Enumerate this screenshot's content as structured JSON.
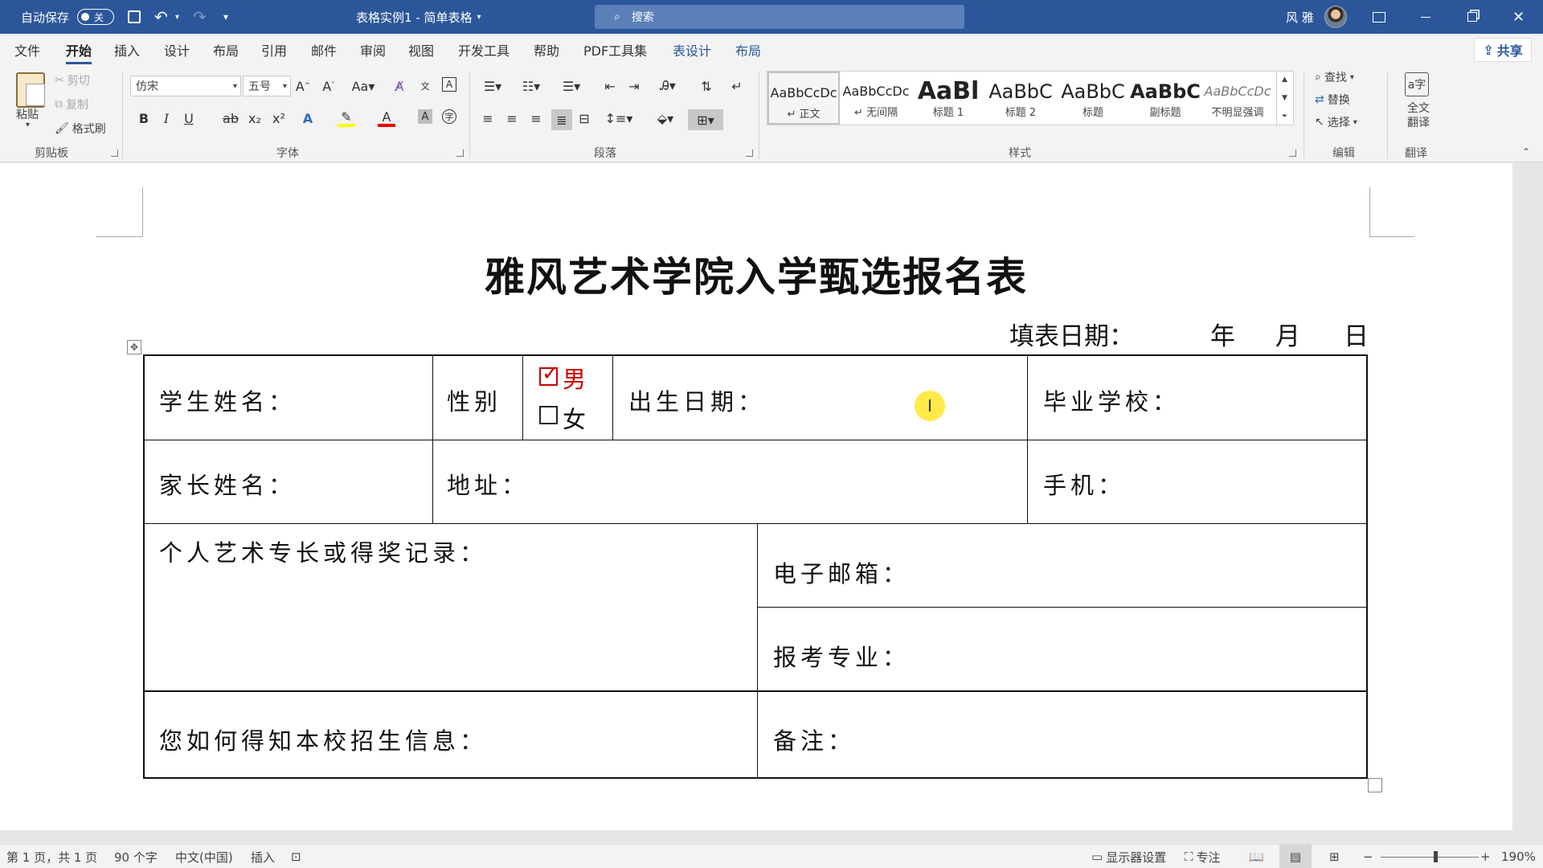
{
  "titlebar": {
    "autosave_label": "自动保存",
    "autosave_state": "关",
    "doc_title": "表格实例1 - 简单表格",
    "search_placeholder": "搜索",
    "user_name": "风 雅"
  },
  "tabs": [
    "文件",
    "开始",
    "插入",
    "设计",
    "布局",
    "引用",
    "邮件",
    "审阅",
    "视图",
    "开发工具",
    "帮助",
    "PDF工具集",
    "表设计",
    "布局"
  ],
  "active_tab": "开始",
  "share_label": "共享",
  "ribbon": {
    "clipboard": {
      "paste": "粘贴",
      "cut": "剪切",
      "copy": "复制",
      "format_painter": "格式刷",
      "label": "剪贴板"
    },
    "font": {
      "font_name": "仿宋",
      "font_size": "五号",
      "label": "字体"
    },
    "paragraph": {
      "label": "段落"
    },
    "styles": {
      "label": "样式",
      "items": [
        {
          "sample": "AaBbCcDc",
          "name": "↵ 正文"
        },
        {
          "sample": "AaBbCcDc",
          "name": "↵ 无间隔"
        },
        {
          "sample": "AaBl",
          "name": "标题 1"
        },
        {
          "sample": "AaBbC",
          "name": "标题 2"
        },
        {
          "sample": "AaBbC",
          "name": "标题"
        },
        {
          "sample": "AaBbC",
          "name": "副标题"
        },
        {
          "sample": "AaBbCcDc",
          "name": "不明显强调"
        }
      ]
    },
    "editing": {
      "find": "查找",
      "replace": "替换",
      "select": "选择",
      "label": "编辑"
    },
    "translate": {
      "button": "全文翻译",
      "label": "翻译"
    }
  },
  "document": {
    "heading": "雅风艺术学院入学甄选报名表",
    "date_label": "填表日期：",
    "date_year": "年",
    "date_month": "月",
    "date_day": "日",
    "table": {
      "student_name": "学生姓名：",
      "gender": "性别",
      "gender_male": "男",
      "gender_female": "女",
      "gender_male_checked": true,
      "birth_date": "出生日期：",
      "school": "毕业学校：",
      "parent_name": "家长姓名：",
      "address": "地址：",
      "mobile": "手机：",
      "art_record": "个人艺术专长或得奖记录：",
      "email": "电子邮箱：",
      "major": "报考专业：",
      "info_source": "您如何得知本校招生信息：",
      "remarks": "备注："
    }
  },
  "statusbar": {
    "page": "第 1 页，共 1 页",
    "words": "90 个字",
    "language": "中文(中国)",
    "mode": "插入",
    "display_settings": "显示器设置",
    "focus": "专注",
    "zoom": "190%"
  }
}
